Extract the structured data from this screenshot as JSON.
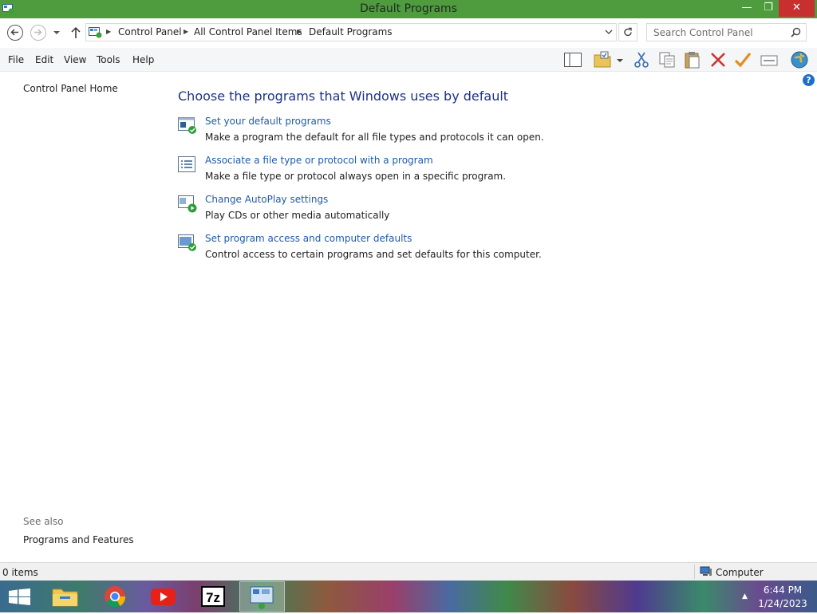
{
  "window": {
    "title": "Default Programs",
    "minimize_glyph": "—",
    "maximize_glyph": "❐",
    "close_glyph": "✕"
  },
  "address_bar": {
    "breadcrumbs": [
      "Control Panel",
      "All Control Panel Items",
      "Default Programs"
    ],
    "search_placeholder": "Search Control Panel"
  },
  "menu": {
    "items": [
      "File",
      "Edit",
      "View",
      "Tools",
      "Help"
    ]
  },
  "toolbar_icons": [
    "layout-icon",
    "folder-options-icon",
    "cut-icon",
    "copy-icon",
    "paste-icon",
    "delete-icon",
    "checkmark-icon",
    "properties-icon",
    "globe-icon"
  ],
  "sidebar": {
    "home_link": "Control Panel Home",
    "see_also_heading": "See also",
    "see_also_links": [
      "Programs and Features"
    ]
  },
  "main": {
    "heading": "Choose the programs that Windows uses by default",
    "tasks": [
      {
        "link": "Set your default programs",
        "desc": "Make a program the default for all file types and protocols it can open.",
        "icon": "default-programs-icon"
      },
      {
        "link": "Associate a file type or protocol with a program",
        "desc": "Make a file type or protocol always open in a specific program.",
        "icon": "file-association-icon"
      },
      {
        "link": "Change AutoPlay settings",
        "desc": "Play CDs or other media automatically",
        "icon": "autoplay-icon"
      },
      {
        "link": "Set program access and computer defaults",
        "desc": "Control access to certain programs and set defaults for this computer.",
        "icon": "program-access-icon"
      }
    ]
  },
  "status_bar": {
    "items_count": "0 items",
    "location": "Computer"
  },
  "taskbar": {
    "apps": [
      "file-explorer-icon",
      "chrome-icon",
      "youtube-icon",
      "7zip-icon",
      "control-panel-icon"
    ],
    "sevenzip_label": "7z",
    "tray_arrow": "▲",
    "time": "6:44 PM",
    "date": "1/24/2023"
  },
  "colors": {
    "titlebar": "#4e9c3e",
    "close_button": "#c7302e",
    "link": "#1e5aa8",
    "heading": "#1e3287"
  }
}
